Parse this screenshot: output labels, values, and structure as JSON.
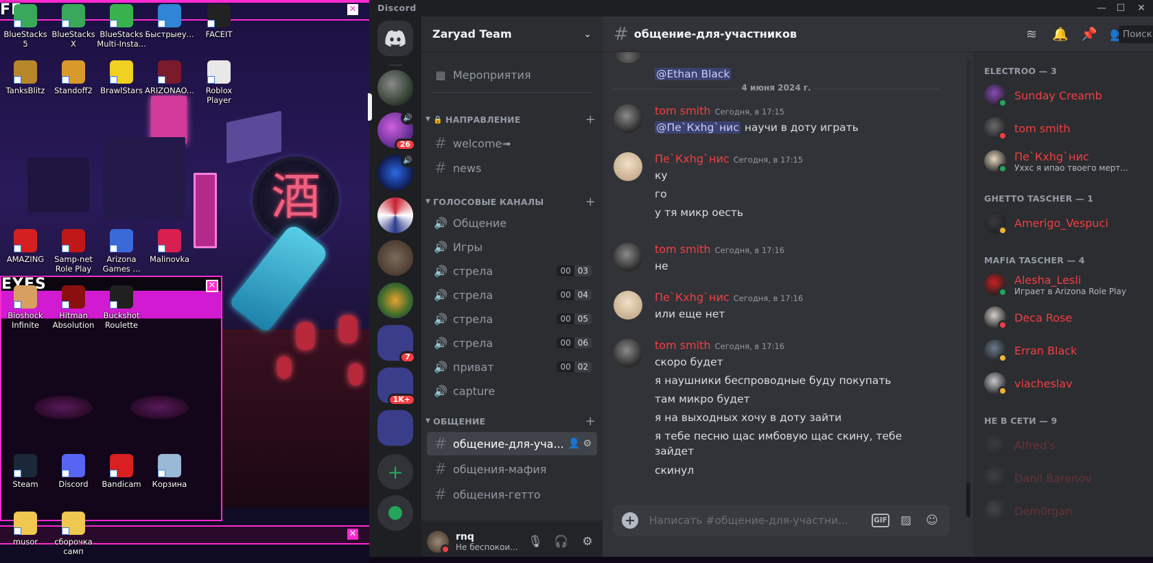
{
  "desktop": {
    "icons": [
      {
        "id": "bluestacks5",
        "label": "BlueStacks 5",
        "color": "#3aa85a"
      },
      {
        "id": "bluestacksx",
        "label": "BlueStacks X",
        "color": "#3aa85a"
      },
      {
        "id": "bluestacksmulti",
        "label": "BlueStacks Multi-Insta...",
        "color": "#37b24d"
      },
      {
        "id": "bystryue",
        "label": "Быстрыеу...",
        "color": "#2f86d6"
      },
      {
        "id": "faceit",
        "label": "FACEIT",
        "color": "#222"
      },
      {
        "id": "tanksblitz",
        "label": "TanksBlitz",
        "color": "#b8862a"
      },
      {
        "id": "standoff2",
        "label": "Standoff2",
        "color": "#d89a2a"
      },
      {
        "id": "brawlstars",
        "label": "BrawlStars",
        "color": "#f0d020"
      },
      {
        "id": "arizona",
        "label": "ARIZONAO...",
        "color": "#7a1a2a"
      },
      {
        "id": "roblox",
        "label": "Roblox Player",
        "color": "#e8e8e8"
      },
      {
        "id": "amazing",
        "label": "AMAZING",
        "color": "#d42020"
      },
      {
        "id": "sampnet",
        "label": "Samp-net Role Play",
        "color": "#c01818"
      },
      {
        "id": "arizonagames",
        "label": "Arizona Games ...",
        "color": "#3a6ad8"
      },
      {
        "id": "malinovka",
        "label": "Malinovka",
        "color": "#d82050"
      },
      {
        "id": "bioshock",
        "label": "Bioshock Infinite",
        "color": "#d8a060"
      },
      {
        "id": "hitman",
        "label": "Hitman Absolution",
        "color": "#8a1010"
      },
      {
        "id": "buckshot",
        "label": "Buckshot Roulette",
        "color": "#202020"
      },
      {
        "id": "steam",
        "label": "Steam",
        "color": "#1b2838"
      },
      {
        "id": "discordico",
        "label": "Discord",
        "color": "#5865f2"
      },
      {
        "id": "bandicam",
        "label": "Bandicam",
        "color": "#d82020"
      },
      {
        "id": "korzina",
        "label": "Корзина",
        "color": "#9ab8d8"
      },
      {
        "id": "musor",
        "label": "musor",
        "color": "#f0c850"
      },
      {
        "id": "sborochka",
        "label": "сборочка самп",
        "color": "#f0c850"
      }
    ],
    "win1_title": "FE",
    "win2_title": "EYES"
  },
  "titlebar": {
    "brand": "Discord",
    "min": "—",
    "max": "☐",
    "close": "✕"
  },
  "rail": {
    "badges": [
      "26",
      "7",
      "1K+"
    ]
  },
  "sidebar": {
    "guild_name": "Zaryad Team",
    "events": "Мероприятия",
    "categories": [
      "НАПРАВЛЕНИЕ",
      "ГОЛОСОВЫЕ КАНАЛЫ",
      "ОБЩЕНИЕ"
    ],
    "text_channels_top": [
      "welcome➟",
      "news"
    ],
    "voice_channels": [
      {
        "name": "Общение",
        "a": "",
        "b": ""
      },
      {
        "name": "Игры",
        "a": "",
        "b": ""
      },
      {
        "name": "стрела",
        "a": "00",
        "b": "03"
      },
      {
        "name": "стрела",
        "a": "00",
        "b": "04"
      },
      {
        "name": "стрела",
        "a": "00",
        "b": "05"
      },
      {
        "name": "стрела",
        "a": "00",
        "b": "06"
      },
      {
        "name": "приват",
        "a": "00",
        "b": "02"
      },
      {
        "name": "capture",
        "a": "",
        "b": ""
      }
    ],
    "text_channels_bottom": [
      "общение-для-уча...",
      "общения-мафия",
      "общения-гетто"
    ],
    "user": {
      "name": "rnq",
      "status": "Не беспокои..."
    }
  },
  "chat": {
    "channel_title": "общение-для-участников",
    "search_placeholder": "Поиск",
    "top_mention": "@Ethan Black",
    "date_divider": "4 июня 2024 г.",
    "messages": [
      {
        "author": "tom smith",
        "time": "Сегодня, в 17:15",
        "mention": "@Пе`Кхhg`нис",
        "lines": [
          "научи в доту играть"
        ]
      },
      {
        "author": "Пе`Кхhg`нис",
        "time": "Сегодня, в 17:15",
        "lines": [
          "ку",
          "го",
          "у тя микр оесть"
        ]
      },
      {
        "author": "tom smith",
        "time": "Сегодня, в 17:16",
        "lines": [
          "не"
        ]
      },
      {
        "author": "Пе`Кхhg`нис",
        "time": "Сегодня, в 17:16",
        "lines": [
          "или еще нет"
        ]
      },
      {
        "author": "tom smith",
        "time": "Сегодня, в 17:16",
        "lines": [
          "скоро будет",
          "я наушники беспроводные буду покупать",
          "там микро будет",
          "я на выходных хочу в доту зайти",
          "я тебе песню щас имбовую щас скину, тебе",
          "зайдет",
          "скинул"
        ]
      }
    ],
    "composer_placeholder": "Написать #общение-для-участни...",
    "gif_label": "GIF"
  },
  "members": {
    "groups": [
      {
        "title": "ELECTROO — 3",
        "items": [
          {
            "name": "Sunday Creamb",
            "sub": "",
            "status": "on"
          },
          {
            "name": "tom smith",
            "sub": "",
            "status": "dnd"
          },
          {
            "name": "Пе`Кхhg`нис",
            "sub": "Уххс я ипао твоего мерт...",
            "status": "on"
          }
        ]
      },
      {
        "title": "GHETTO TASCHER — 1",
        "items": [
          {
            "name": "Amerigo_Vespuci",
            "sub": "",
            "status": "idle"
          }
        ]
      },
      {
        "title": "MAFIA TASCHER — 4",
        "items": [
          {
            "name": "Alesha_Lesli",
            "sub": "Играет в Arizona Role Play",
            "status": "on"
          },
          {
            "name": "Deca Rose",
            "sub": "",
            "status": "dnd"
          },
          {
            "name": "Erran Black",
            "sub": "",
            "status": "idle"
          },
          {
            "name": "viacheslav",
            "sub": "",
            "status": "idle"
          }
        ]
      },
      {
        "title": "НЕ В СЕТИ — 9",
        "items": [
          {
            "name": "Alfred's",
            "sub": "",
            "status": "off"
          },
          {
            "name": "Danil Barenov",
            "sub": "",
            "status": "off"
          },
          {
            "name": "Dem0rgan",
            "sub": "",
            "status": "off"
          }
        ]
      }
    ]
  }
}
